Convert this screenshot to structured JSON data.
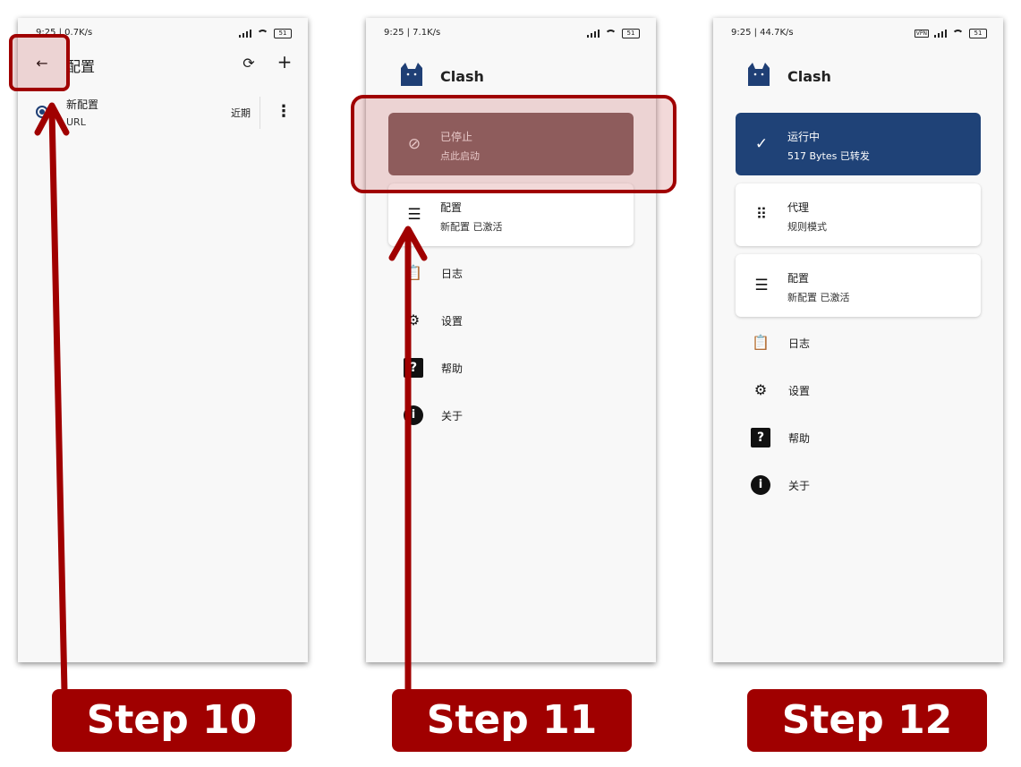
{
  "screens": [
    {
      "status": {
        "time_speed": "9:25 | 0.7K/s"
      },
      "header": {
        "title": "配置"
      },
      "profile": {
        "name": "新配置",
        "type": "URL",
        "time": "近期"
      }
    },
    {
      "status": {
        "time_speed": "9:25 | 7.1K/s"
      },
      "app_name": "Clash",
      "status_card": {
        "title": "已停止",
        "subtitle": "点此启动"
      },
      "profile_card": {
        "title": "配置",
        "subtitle": "新配置 已激活"
      },
      "menu": [
        {
          "label": "日志",
          "icon": "clipboard-icon"
        },
        {
          "label": "设置",
          "icon": "gear-icon"
        },
        {
          "label": "帮助",
          "icon": "help-icon"
        },
        {
          "label": "关于",
          "icon": "info-icon"
        }
      ]
    },
    {
      "status": {
        "time_speed": "9:25 | 44.7K/s"
      },
      "app_name": "Clash",
      "status_card": {
        "title": "运行中",
        "subtitle": "517 Bytes 已转发"
      },
      "proxy_card": {
        "title": "代理",
        "subtitle": "规则模式"
      },
      "profile_card": {
        "title": "配置",
        "subtitle": "新配置 已激活"
      },
      "menu": [
        {
          "label": "日志",
          "icon": "clipboard-icon"
        },
        {
          "label": "设置",
          "icon": "gear-icon"
        },
        {
          "label": "帮助",
          "icon": "help-icon"
        },
        {
          "label": "关于",
          "icon": "info-icon"
        }
      ]
    }
  ],
  "steps": [
    "Step 10",
    "Step 11",
    "Step 12"
  ],
  "colors": {
    "highlight": "#a00000",
    "running": "#1f4277",
    "stopped": "#8a6d6d"
  }
}
